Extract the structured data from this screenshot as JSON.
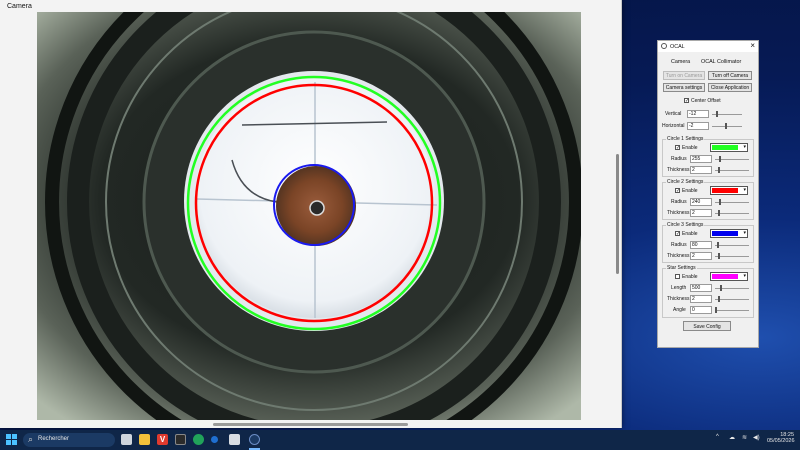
{
  "camera_window": {
    "title": "Camera"
  },
  "ocal": {
    "title": "OCAL",
    "tabs": [
      "Camera",
      "OCAL Collimator"
    ],
    "buttons": {
      "turn_on": "Turn on Camera",
      "turn_off": "Turn off Camera",
      "settings": "Camera settings",
      "close": "Close Application",
      "save": "Save Config"
    },
    "center_offset": {
      "label": "Center Offset",
      "checked": true
    },
    "vertical": {
      "label": "Vertical",
      "value": "-12"
    },
    "horizontal": {
      "label": "Horizontal",
      "value": "-2"
    },
    "circle1": {
      "title": "Circle 1 Settings",
      "enable": "Enable",
      "enabled": true,
      "color": "#22ff22",
      "radius_label": "Radius",
      "radius": "255",
      "thickness_label": "Thickness",
      "thickness": "2"
    },
    "circle2": {
      "title": "Circle 2 Settings",
      "enable": "Enable",
      "enabled": true,
      "color": "#ff0000",
      "radius_label": "Radius",
      "radius": "240",
      "thickness_label": "Thickness",
      "thickness": "2"
    },
    "circle3": {
      "title": "Circle 3 Settings",
      "enable": "Enable",
      "enabled": true,
      "color": "#0000ee",
      "radius_label": "Radius",
      "radius": "80",
      "thickness_label": "Thickness",
      "thickness": "2"
    },
    "star": {
      "title": "Star Settings",
      "enable": "Enable",
      "enabled": false,
      "color": "#ff00ff",
      "length_label": "Length",
      "length": "500",
      "thickness_label": "Thickness",
      "thickness": "2",
      "angle_label": "Angle",
      "angle": "0"
    }
  },
  "taskbar": {
    "search_placeholder": "Rechercher",
    "time": "18:25",
    "date": "05/05/2026"
  }
}
